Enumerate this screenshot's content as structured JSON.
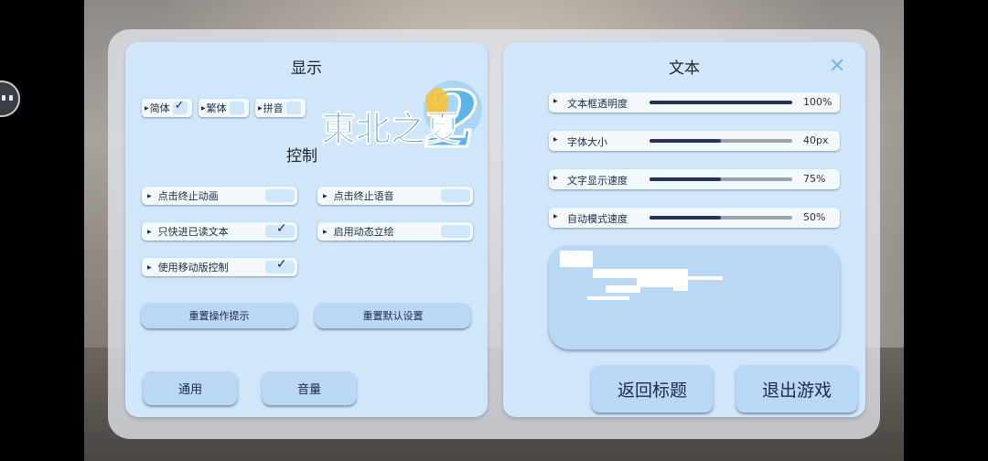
{
  "display_panel": {
    "title": "显示",
    "languages": [
      {
        "label": "简体",
        "checked": true
      },
      {
        "label": "繁体",
        "checked": false
      },
      {
        "label": "拼音",
        "checked": false
      }
    ],
    "logo_text": "東北之夏",
    "logo_number": "2",
    "control_label": "控制",
    "options": [
      {
        "label": "点击终止动画",
        "checked": false
      },
      {
        "label": "点击终止语音",
        "checked": false
      },
      {
        "label": "只快进已读文本",
        "checked": true
      },
      {
        "label": "启用动态立绘",
        "checked": false
      },
      {
        "label": "使用移动版控制",
        "checked": true
      }
    ],
    "reset_hints_label": "重置操作提示",
    "reset_defaults_label": "重置默认设置",
    "tab_general_label": "通用",
    "tab_volume_label": "音量"
  },
  "text_panel": {
    "title": "文本",
    "sliders": [
      {
        "label": "文本框透明度",
        "value_text": "100%",
        "fraction": 1.0
      },
      {
        "label": "字体大小",
        "value_text": "40px",
        "fraction": 0.5
      },
      {
        "label": "文字显示速度",
        "value_text": "75%",
        "fraction": 0.5
      },
      {
        "label": "自动模式速度",
        "value_text": "50%",
        "fraction": 0.5
      }
    ],
    "return_title_label": "返回标题",
    "exit_game_label": "退出游戏"
  },
  "icons": {
    "close": "close-icon",
    "check": "check-icon",
    "arrow": "triangle-right-icon",
    "camera": "camera-icon"
  },
  "colors": {
    "panel": "#cfe6fb",
    "button": "#bad7f6",
    "slider_fill": "#243458",
    "close_icon": "#7fb7e3"
  }
}
